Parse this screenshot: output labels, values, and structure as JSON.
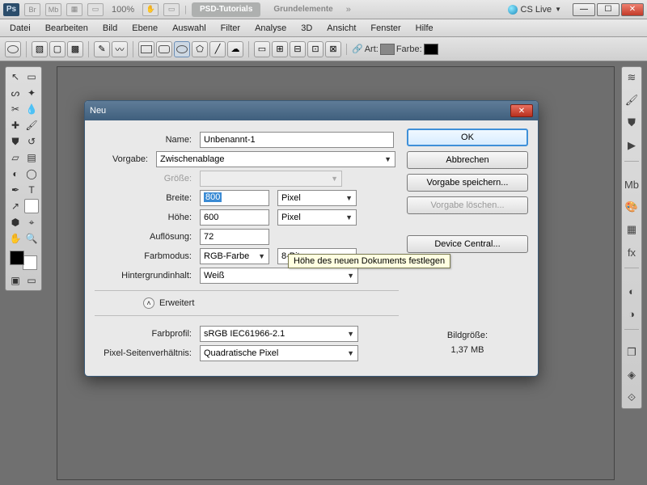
{
  "appbar": {
    "logo": "Ps",
    "mini1": "Br",
    "mini2": "Mb",
    "zoom": "100%",
    "tab_active": "PSD-Tutorials",
    "tab_inactive": "Grundelemente",
    "cslive": "CS Live"
  },
  "menubar": [
    "Datei",
    "Bearbeiten",
    "Bild",
    "Ebene",
    "Auswahl",
    "Filter",
    "Analyse",
    "3D",
    "Ansicht",
    "Fenster",
    "Hilfe"
  ],
  "optbar": {
    "art": "Art:",
    "farbe": "Farbe:"
  },
  "dialog": {
    "title": "Neu",
    "name_label": "Name:",
    "name_value": "Unbenannt-1",
    "preset_label": "Vorgabe:",
    "preset_value": "Zwischenablage",
    "size_label": "Größe:",
    "width_label": "Breite:",
    "width_value": "800",
    "width_unit": "Pixel",
    "height_label": "Höhe:",
    "height_value": "600",
    "height_unit": "Pixel",
    "res_label": "Auflösung:",
    "res_value": "72",
    "mode_label": "Farbmodus:",
    "mode_value": "RGB-Farbe",
    "depth_value": "8-Bit",
    "bg_label": "Hintergrundinhalt:",
    "bg_value": "Weiß",
    "advanced": "Erweitert",
    "profile_label": "Farbprofil:",
    "profile_value": "sRGB IEC61966-2.1",
    "par_label": "Pixel-Seitenverhältnis:",
    "par_value": "Quadratische Pixel",
    "ok": "OK",
    "cancel": "Abbrechen",
    "save_preset": "Vorgabe speichern...",
    "delete_preset": "Vorgabe löschen...",
    "device_central": "Device Central...",
    "size_caption": "Bildgröße:",
    "size_value": "1,37 MB",
    "tooltip": "Höhe des neuen Dokuments festlegen"
  }
}
